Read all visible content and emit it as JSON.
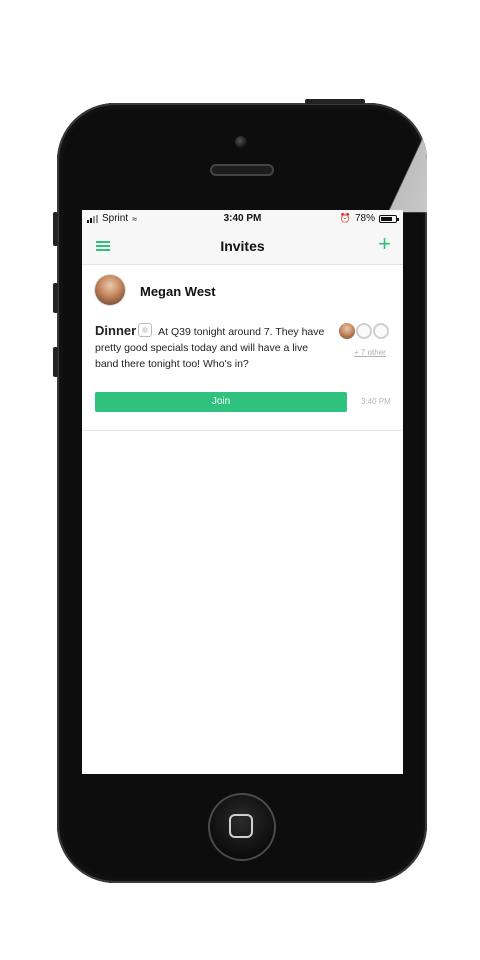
{
  "status_bar": {
    "carrier": "Sprint",
    "time": "3:40 PM",
    "battery_percent": "78%",
    "battery_level": 0.78
  },
  "nav": {
    "title": "Invites",
    "menu_icon": "hamburger-menu-icon",
    "add_icon": "plus-icon",
    "add_symbol": "+"
  },
  "invite": {
    "sender_name": "Megan West",
    "title": "Dinner",
    "message": "At Q39 tonight around 7. They have pretty good specials today and will have a live band there tonight too! Who's in?",
    "others_label": "+ 7 other",
    "join_label": "Join",
    "timestamp": "3:40 PM"
  },
  "colors": {
    "accent": "#2ec27e",
    "muted_text": "#b0b0b0"
  }
}
